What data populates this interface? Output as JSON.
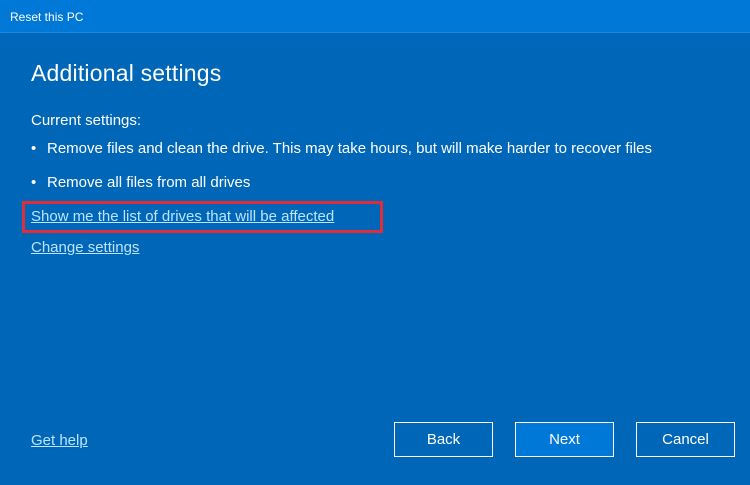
{
  "window": {
    "title": "Reset this PC"
  },
  "page": {
    "heading": "Additional settings",
    "current_settings_label": "Current settings:",
    "bullets": [
      "Remove files and clean the drive. This may take hours, but will make harder to recover files",
      "Remove all files from all drives"
    ],
    "bullet_glyph": "•"
  },
  "links": {
    "drives": "Show me the list of drives that will be affected",
    "change_settings": "Change settings",
    "get_help": "Get help"
  },
  "buttons": {
    "back": "Back",
    "next": "Next",
    "cancel": "Cancel"
  },
  "colors": {
    "background": "#0067b8",
    "titlebar": "#0078d7",
    "link": "#bde3ff",
    "highlight": "#e02d3c"
  }
}
